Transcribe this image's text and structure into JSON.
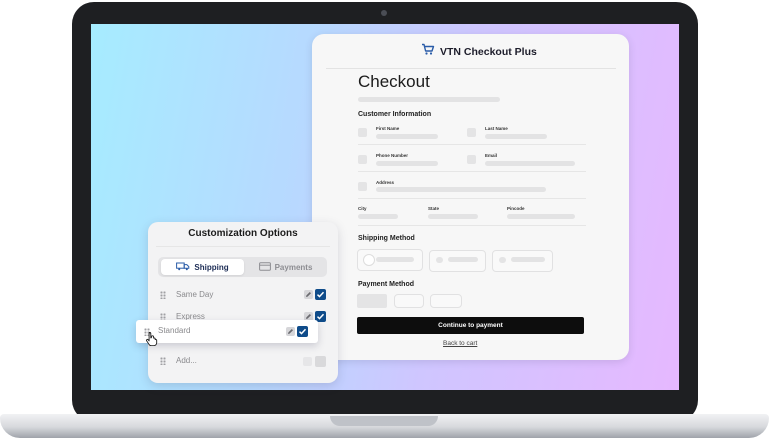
{
  "checkout": {
    "brand": "VTN Checkout Plus",
    "title": "Checkout",
    "customer_section": "Customer Information",
    "first_name": "First Name",
    "last_name": "Last Name",
    "phone": "Phone Number",
    "email": "Email",
    "address": "Address",
    "city": "City",
    "state": "State",
    "pincode": "Pincode",
    "shipping_section": "Shipping Method",
    "payment_section": "Payment Method",
    "cta": "Continue to payment",
    "back": "Back to cart"
  },
  "panel": {
    "title": "Customization Options",
    "tabs": [
      {
        "label": "Shipping",
        "active": true
      },
      {
        "label": "Payments",
        "active": false
      }
    ],
    "items": [
      {
        "label": "Same Day",
        "checked": true
      },
      {
        "label": "Express",
        "checked": true
      },
      {
        "label": "Standard",
        "checked": true,
        "dragging": true
      },
      {
        "label": "Add...",
        "checked": false
      }
    ]
  },
  "colors": {
    "accent": "#0f4c8a",
    "cta": "#0d0d0d",
    "brand_icon": "#2a5ca8"
  },
  "icons": [
    "cart-icon",
    "truck-icon",
    "card-icon",
    "drag-handle-icon",
    "pencil-icon",
    "checkbox-icon",
    "cursor-hand-icon"
  ]
}
